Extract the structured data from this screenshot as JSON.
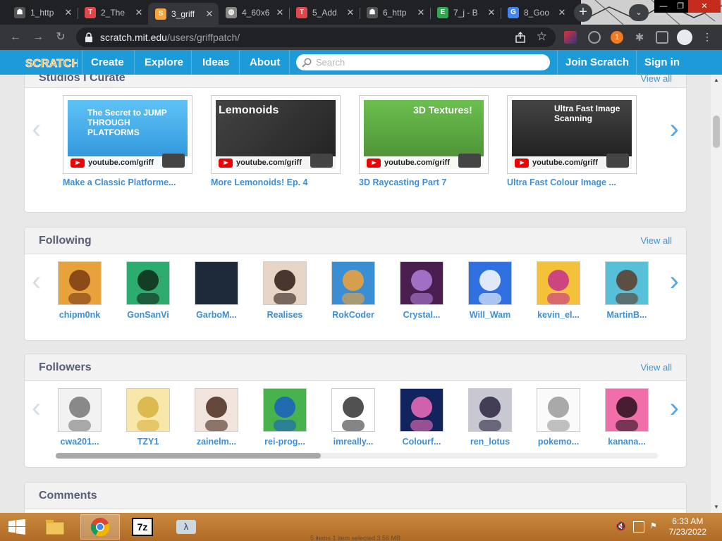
{
  "browser": {
    "tabs": [
      {
        "title": "1_http",
        "favicon": "scratch-cat-icon",
        "color": "#555"
      },
      {
        "title": "2_The",
        "favicon": "t-icon",
        "color": "#e0474c"
      },
      {
        "title": "3_griff",
        "favicon": "scratch-s-icon",
        "color": "#f7a43a",
        "active": true
      },
      {
        "title": "4_60x6",
        "favicon": "globe-icon",
        "color": "#888"
      },
      {
        "title": "5_Add",
        "favicon": "t-icon",
        "color": "#e0474c"
      },
      {
        "title": "6_http",
        "favicon": "scratch-cat-icon",
        "color": "#555"
      },
      {
        "title": "7_j - B",
        "favicon": "e-icon",
        "color": "#2fa84f"
      },
      {
        "title": "8_Goo",
        "favicon": "google-icon",
        "color": "#4285f4"
      }
    ],
    "new_tab": "+",
    "url_host": "scratch.mit.edu",
    "url_path": "/users/griffpatch/",
    "badge_count": "1"
  },
  "scratch_nav": {
    "logo": "SCRATCH",
    "create": "Create",
    "explore": "Explore",
    "ideas": "Ideas",
    "about": "About",
    "search_placeholder": "Search",
    "join": "Join Scratch",
    "signin": "Sign in"
  },
  "studios": {
    "title": "Studios I Curate",
    "view_all": "View all",
    "items": [
      {
        "title": "Make a Classic Platforme...",
        "caption": "youtube.com/griff",
        "art_text": "The Secret to JUMP THROUGH PLATFORMS"
      },
      {
        "title": "More Lemonoids! Ep. 4",
        "caption": "youtube.com/griff",
        "art_text": "Lemonoids"
      },
      {
        "title": "3D Raycasting Part 7",
        "caption": "youtube.com/griff",
        "art_text": "3D Textures!"
      },
      {
        "title": "Ultra Fast Colour Image ...",
        "caption": "youtube.com/griff",
        "art_text": "Ultra Fast Image Scanning"
      }
    ]
  },
  "following": {
    "title": "Following",
    "view_all": "View all",
    "users": [
      "chipm0nk",
      "GonSanVi",
      "GarboM...",
      "Realises",
      "RokCoder",
      "Crystal...",
      "Will_Wam",
      "kevin_el...",
      "MartinB..."
    ]
  },
  "followers": {
    "title": "Followers",
    "view_all": "View all",
    "users": [
      "cwa201...",
      "TZY1",
      "zainelm...",
      "rei-prog...",
      "imreally...",
      "Colourf...",
      "ren_lotus",
      "pokemo...",
      "kanana..."
    ],
    "scroll_fraction": 0.44
  },
  "comments": {
    "title": "Comments"
  },
  "taskbar": {
    "time": "6:33 AM",
    "date": "7/23/2022",
    "status": "5 items   1 item selected  3.56 MB"
  },
  "colors": {
    "scratch_blue": "#1c9bd8",
    "link_blue": "#3f8ed4",
    "heading_gray": "#575e75"
  }
}
